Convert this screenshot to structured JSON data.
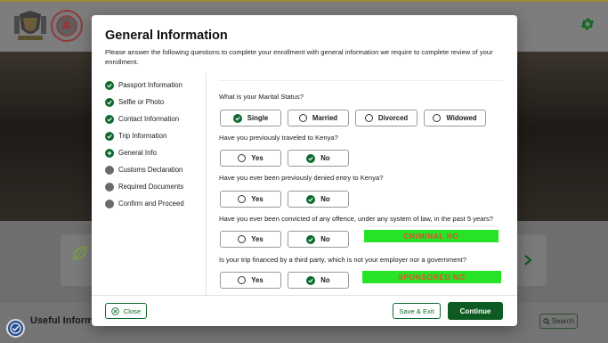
{
  "background": {
    "useful_info_label": "Useful Informat",
    "search_label": "Search"
  },
  "modal": {
    "title": "General Information",
    "description": "Please answer the following questions to complete your enrollment with general information we require to complete review of your enrollment."
  },
  "steps": [
    {
      "label": "Passport Information",
      "status": "done"
    },
    {
      "label": "Selfie or Photo",
      "status": "done"
    },
    {
      "label": "Contact Information",
      "status": "done"
    },
    {
      "label": "Trip Information",
      "status": "done"
    },
    {
      "label": "General Info",
      "status": "current"
    },
    {
      "label": "Customs Declaration",
      "status": "pending"
    },
    {
      "label": "Required Documents",
      "status": "pending"
    },
    {
      "label": "Confirm and Proceed",
      "status": "pending"
    }
  ],
  "questions": {
    "marital": {
      "text": "What is your Marital Status?",
      "options": [
        "Single",
        "Married",
        "Divorced",
        "Widowed"
      ],
      "selected": "Single"
    },
    "traveled": {
      "text": "Have you previously traveled to Kenya?",
      "options": [
        "Yes",
        "No"
      ],
      "selected": "No"
    },
    "denied": {
      "text": "Have you ever been previously denied entry to Kenya?",
      "options": [
        "Yes",
        "No"
      ],
      "selected": "No"
    },
    "convicted": {
      "text": "Have you ever been convicted of any offence, under any system of law, in the past 5 years?",
      "options": [
        "Yes",
        "No"
      ],
      "selected": "No",
      "tag": "CRIMINAL NO"
    },
    "financed": {
      "text": "Is your trip financed by a third party, which is not your employer nor a government?",
      "options": [
        "Yes",
        "No"
      ],
      "selected": "No",
      "tag": "SPONSORED NO"
    }
  },
  "buttons": {
    "close": "Close",
    "save_exit": "Save & Exit",
    "continue": "Continue"
  },
  "colors": {
    "brand_green": "#0e6b2e",
    "tag_background": "#27e327",
    "tag_text": "#e0512b"
  }
}
